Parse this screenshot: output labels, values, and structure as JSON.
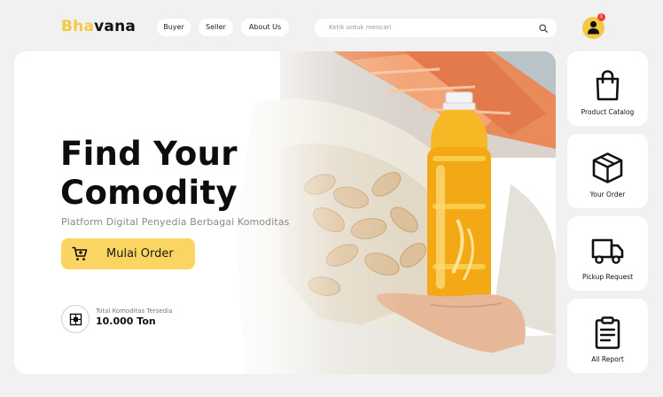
{
  "header": {
    "logo_accent": "Bha",
    "logo_rest": "vana",
    "nav": [
      "Buyer",
      "Seller",
      "About Us"
    ],
    "search_placeholder": "Ketik untuk mencari",
    "notification_count": "1"
  },
  "hero": {
    "title_line1": "Find Your",
    "title_line2": "Comodity",
    "subtitle": "Platform Digital Penyedia Berbagai Komoditas",
    "cta_label": "Mulai Order",
    "stat_label": "Total Komoditas Tersedia",
    "stat_value": "10.000 Ton"
  },
  "side_menu": [
    {
      "label": "Product Catalog",
      "icon": "shopping-bag-icon"
    },
    {
      "label": "Your Order",
      "icon": "box-icon"
    },
    {
      "label": "Pickup Request",
      "icon": "truck-icon"
    },
    {
      "label": "All Report",
      "icon": "clipboard-icon"
    }
  ],
  "colors": {
    "accent": "#f5c842",
    "button": "#fbd561",
    "badge": "#e8403a",
    "background": "#f1f1f1"
  }
}
